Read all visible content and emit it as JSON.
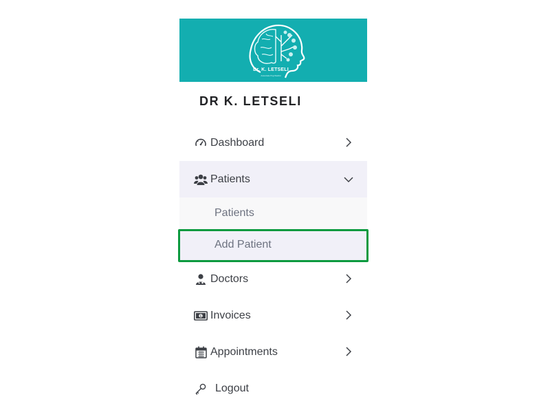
{
  "banner": {
    "logo_text": "Dr. K. LETSELI",
    "logo_subtext": "Associate Psychiatrist",
    "background_color": "#13aeb0"
  },
  "brand": {
    "title": "DR K. LETSELI"
  },
  "menu": {
    "items": [
      {
        "label": "Dashboard",
        "icon": "gauge-icon",
        "chevron": "chevron-right-icon"
      },
      {
        "label": "Patients",
        "icon": "users-icon",
        "chevron": "chevron-down-icon",
        "expanded": true
      },
      {
        "label": "Doctors",
        "icon": "doctor-icon",
        "chevron": "chevron-right-icon"
      },
      {
        "label": "Invoices",
        "icon": "money-bill-icon",
        "chevron": "chevron-right-icon"
      },
      {
        "label": "Appointments",
        "icon": "calendar-icon",
        "chevron": "chevron-right-icon"
      },
      {
        "label": "Logout",
        "icon": "key-icon"
      }
    ],
    "patients_submenu": [
      {
        "label": "Patients"
      },
      {
        "label": "Add Patient",
        "highlighted": true
      }
    ]
  },
  "colors": {
    "highlight_border": "#0c9a3f",
    "active_bg": "#f1f0f8"
  }
}
